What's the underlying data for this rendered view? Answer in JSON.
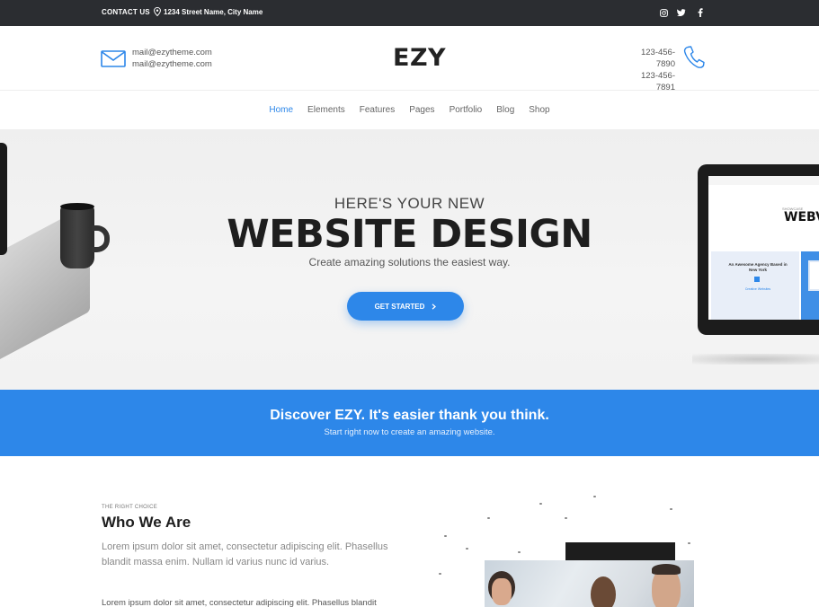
{
  "topbar": {
    "contact_label": "CONTACT US",
    "address": "1234 Street Name, City Name",
    "social_icons": [
      "instagram-icon",
      "twitter-icon",
      "facebook-icon"
    ]
  },
  "header": {
    "emails": [
      "mail@ezytheme.com",
      "mail@ezytheme.com"
    ],
    "logo": "EZY",
    "phones": [
      "123-456-7890",
      "123-456-7891"
    ]
  },
  "nav": {
    "items": [
      "Home",
      "Elements",
      "Features",
      "Pages",
      "Portfolio",
      "Blog",
      "Shop"
    ],
    "active": "Home"
  },
  "hero": {
    "pre_title": "HERE'S YOUR NEW",
    "title": "WEBSITE DESIGN",
    "subtitle": "Create amazing solutions the easiest way.",
    "cta_label": "GET STARTED",
    "monitor": {
      "tagline": "SHOWCASE",
      "headline": "WEBV",
      "panel_title": "An Awesome Agency Based in New York",
      "panel_sub": "Creative Websites"
    }
  },
  "band": {
    "title": "Discover EZY. It's easier thank you think.",
    "subtitle": "Start right now to create an amazing website."
  },
  "about": {
    "kicker": "THE RIGHT CHOICE",
    "title": "Who We Are",
    "lead": "Lorem ipsum dolor sit amet, consectetur adipiscing elit. Phasellus blandit massa enim. Nullam id varius nunc id varius.",
    "body": "Lorem ipsum dolor sit amet, consectetur adipiscing elit. Phasellus blandit massa enim. Nullam id varius nunc. Vivamus bibendum magna ex, et"
  },
  "colors": {
    "accent": "#2d87e9",
    "topbar": "#2b2d31",
    "text_dark": "#1e1e1e"
  }
}
